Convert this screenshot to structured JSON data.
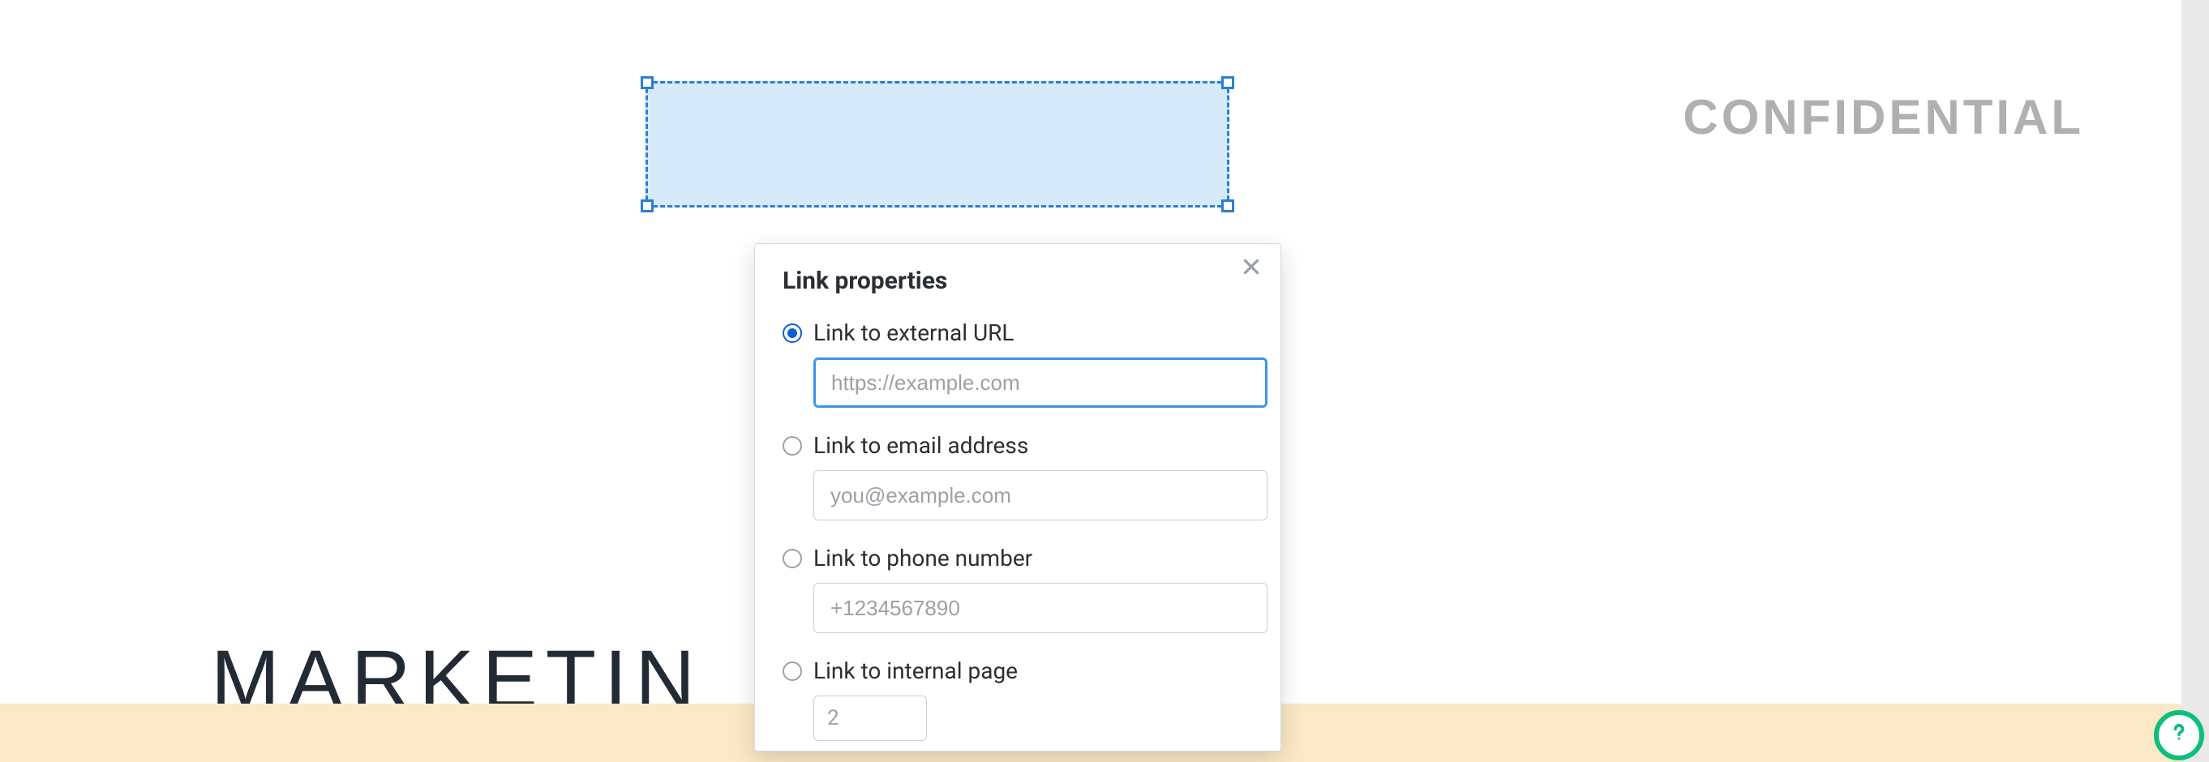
{
  "document": {
    "watermark": "CONFIDENTIAL",
    "headline_visible": "MARKETIN"
  },
  "popup": {
    "title": "Link properties",
    "options": {
      "external": {
        "label": "Link to external URL",
        "placeholder": "https://example.com",
        "value": ""
      },
      "email": {
        "label": "Link to email address",
        "placeholder": "you@example.com",
        "value": ""
      },
      "phone": {
        "label": "Link to phone number",
        "placeholder": "+1234567890",
        "value": ""
      },
      "internal": {
        "label": "Link to internal page",
        "value": "2"
      }
    }
  }
}
